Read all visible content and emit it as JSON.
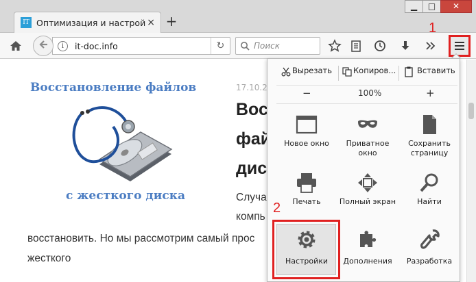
{
  "tab": {
    "favicon": "IT",
    "title": "Оптимизация и настройка",
    "close": "×"
  },
  "newtab": "+",
  "window": {
    "minimize": "▁",
    "maximize": "□",
    "close": "✕"
  },
  "navbar": {
    "url": "it-doc.info",
    "info": "i",
    "reload": "↻",
    "search_placeholder": "Поиск"
  },
  "annotations": {
    "one": "1",
    "two": "2"
  },
  "article": {
    "image_title": "Восстановление файлов",
    "image_caption": "с жесткого диска",
    "date": "17.10.2",
    "heading_lines": [
      "Вос",
      "фай",
      "дис"
    ],
    "body_lines": [
      "Случа",
      "компь",
      "восстановить. Но мы рассмотрим самый прос",
      "жесткого"
    ]
  },
  "menu": {
    "edit": {
      "cut": "Вырезать",
      "copy": "Копиров...",
      "paste": "Вставить"
    },
    "zoom": {
      "out": "−",
      "level": "100%",
      "in": "+"
    },
    "items": [
      {
        "label": "Новое окно",
        "icon": "new-window-icon"
      },
      {
        "label": "Приватное окно",
        "icon": "private-mask-icon"
      },
      {
        "label": "Сохранить страницу",
        "icon": "save-page-icon"
      },
      {
        "label": "Печать",
        "icon": "printer-icon"
      },
      {
        "label": "Полный экран",
        "icon": "fullscreen-icon"
      },
      {
        "label": "Найти",
        "icon": "find-icon"
      },
      {
        "label": "Настройки",
        "icon": "gear-icon"
      },
      {
        "label": "Дополнения",
        "icon": "puzzle-icon"
      },
      {
        "label": "Разработка",
        "icon": "wrench-icon"
      }
    ]
  },
  "colors": {
    "annotation_red": "#e02020",
    "image_text_blue": "#4a7cc2",
    "favicon_blue": "#2c9fd8"
  }
}
